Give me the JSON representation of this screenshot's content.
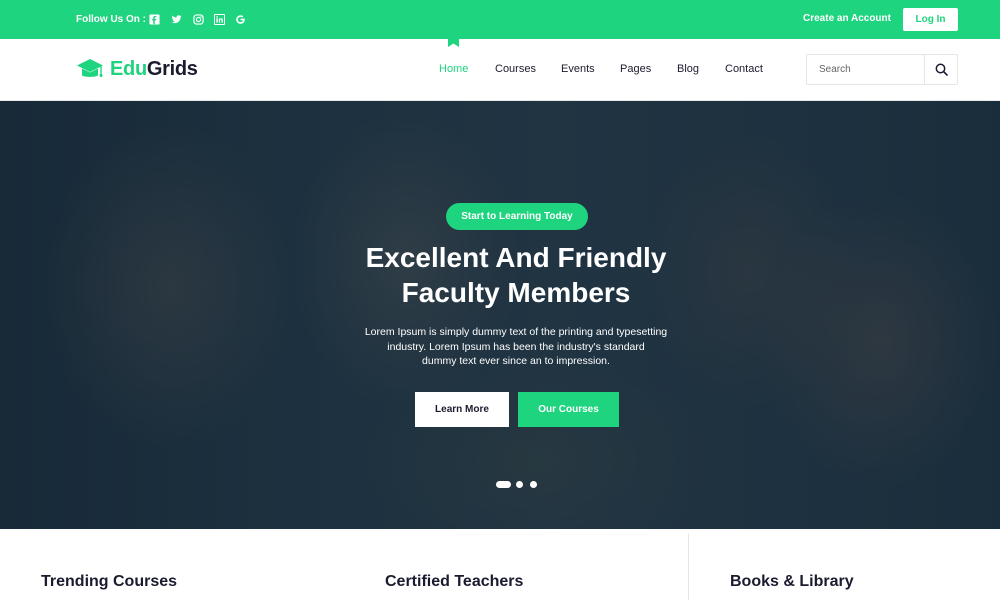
{
  "topbar": {
    "follow_label": "Follow Us On :",
    "social_icons": [
      "facebook-icon",
      "twitter-icon",
      "instagram-icon",
      "linkedin-icon",
      "google-icon"
    ],
    "create_account": "Create an Account",
    "login": "Log In"
  },
  "brand": {
    "name_part1": "Edu",
    "name_part2": "Grids",
    "accent_color": "#1fd47f",
    "dark_color": "#1b1b2f"
  },
  "nav": {
    "items": [
      {
        "label": "Home",
        "active": true
      },
      {
        "label": "Courses",
        "active": false
      },
      {
        "label": "Events",
        "active": false
      },
      {
        "label": "Pages",
        "active": false
      },
      {
        "label": "Blog",
        "active": false
      },
      {
        "label": "Contact",
        "active": false
      }
    ],
    "search_placeholder": "Search"
  },
  "hero": {
    "badge": "Start to Learning Today",
    "title_line1": "Excellent And Friendly",
    "title_line2": "Faculty Members",
    "desc_line1": "Lorem Ipsum is simply dummy text of the printing and typesetting",
    "desc_line2": "industry. Lorem Ipsum has been the industry's standard",
    "desc_line3": "dummy text ever since an to impression.",
    "btn_learn": "Learn More",
    "btn_courses": "Our Courses",
    "slide_count": 3,
    "active_slide": 1
  },
  "features": [
    {
      "title": "Trending Courses"
    },
    {
      "title": "Certified Teachers"
    },
    {
      "title": "Books & Library"
    }
  ]
}
